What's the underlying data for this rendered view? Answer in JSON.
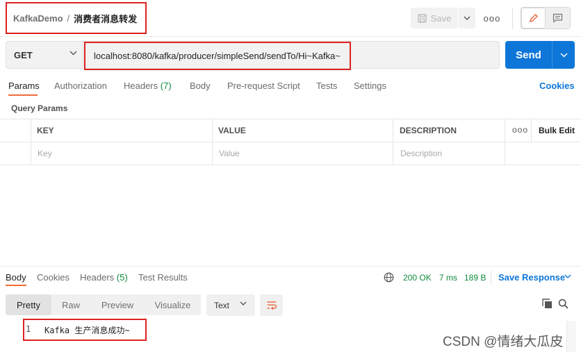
{
  "header": {
    "breadcrumb_parent": "KafkaDemo",
    "breadcrumb_separator": "/",
    "request_name": "消费者消息转发",
    "save_label": "Save",
    "more_label": "ooo"
  },
  "request": {
    "method": "GET",
    "url": "localhost:8080/kafka/producer/simpleSend/sendTo/Hi~Kafka~",
    "send_label": "Send"
  },
  "tabs": [
    {
      "label": "Params",
      "active": true
    },
    {
      "label": "Authorization"
    },
    {
      "label": "Headers",
      "count": "(7)"
    },
    {
      "label": "Body"
    },
    {
      "label": "Pre-request Script"
    },
    {
      "label": "Tests"
    },
    {
      "label": "Settings"
    }
  ],
  "cookies_link": "Cookies",
  "query_params": {
    "title": "Query Params",
    "columns": [
      "KEY",
      "VALUE",
      "DESCRIPTION"
    ],
    "more_label": "ooo",
    "bulk_edit": "Bulk Edit",
    "placeholders": {
      "key": "Key",
      "value": "Value",
      "description": "Description"
    }
  },
  "response": {
    "tabs": [
      {
        "label": "Body",
        "active": true
      },
      {
        "label": "Cookies"
      },
      {
        "label": "Headers",
        "count": "(5)"
      },
      {
        "label": "Test Results"
      }
    ],
    "status": "200 OK",
    "time": "7 ms",
    "size": "189 B",
    "save_response": "Save Response",
    "formats": [
      "Pretty",
      "Raw",
      "Preview",
      "Visualize"
    ],
    "active_format": "Pretty",
    "language": "Text",
    "lines": [
      {
        "no": "1",
        "text": "Kafka 生产消息成功~"
      }
    ]
  },
  "watermark": "CSDN @情绪大瓜皮",
  "colors": {
    "accent_blue": "#0e76d8",
    "tab_underline": "#f26b3a",
    "status_green": "#0f8a3a",
    "highlight_red": "#e02020"
  }
}
